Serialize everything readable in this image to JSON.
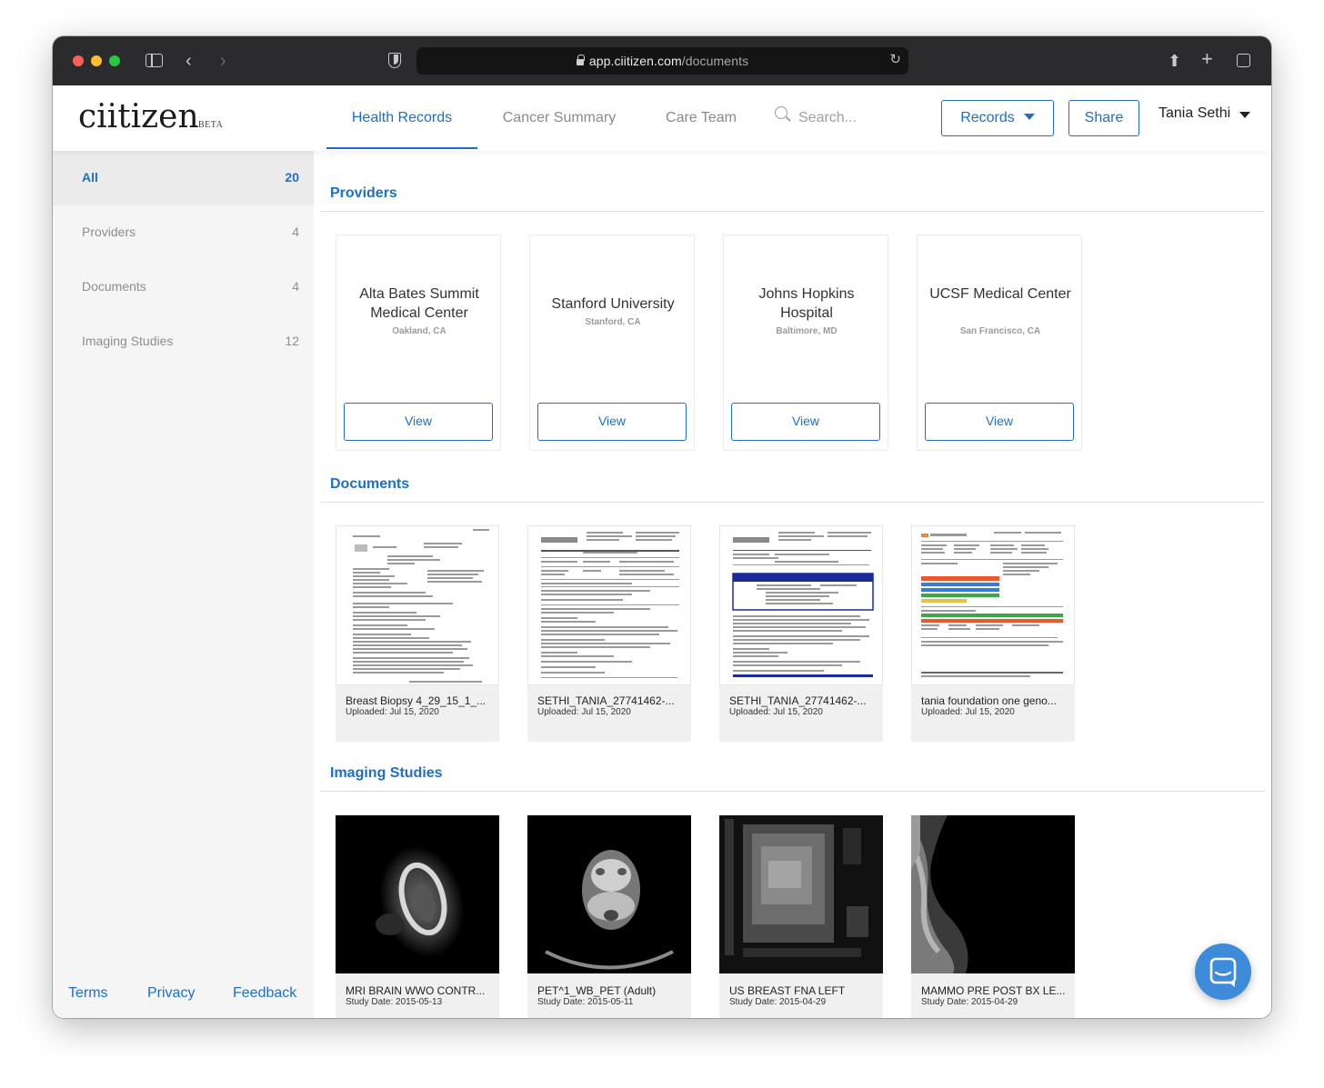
{
  "browser": {
    "url_host": "app.ciitizen.com",
    "url_path": "/documents"
  },
  "header": {
    "logo": "ciitizen",
    "logo_badge": "BETA",
    "tabs": [
      {
        "label": "Health Records",
        "active": true
      },
      {
        "label": "Cancer Summary",
        "active": false
      },
      {
        "label": "Care Team",
        "active": false
      }
    ],
    "search_placeholder": "Search...",
    "records_button": "Records",
    "share_button": "Share",
    "user_name": "Tania Sethi"
  },
  "sidebar": {
    "items": [
      {
        "label": "All",
        "count": "20",
        "active": true
      },
      {
        "label": "Providers",
        "count": "4",
        "active": false
      },
      {
        "label": "Documents",
        "count": "4",
        "active": false
      },
      {
        "label": "Imaging Studies",
        "count": "12",
        "active": false
      }
    ],
    "footer": {
      "terms": "Terms",
      "privacy": "Privacy",
      "feedback": "Feedback"
    }
  },
  "sections": {
    "providers_title": "Providers",
    "documents_title": "Documents",
    "imaging_title": "Imaging Studies"
  },
  "providers": [
    {
      "name": "Alta Bates Summit Medical Center",
      "location": "Oakland, CA",
      "button": "View"
    },
    {
      "name": "Stanford University",
      "location": "Stanford, CA",
      "button": "View"
    },
    {
      "name": "Johns Hopkins Hospital",
      "location": "Baltimore, MD",
      "button": "View"
    },
    {
      "name": "UCSF Medical Center",
      "location": "San Francisco, CA",
      "button": "View"
    }
  ],
  "documents": [
    {
      "name": "Breast Biopsy 4_29_15_1_...",
      "uploaded": "Uploaded: Jul 15, 2020"
    },
    {
      "name": "SETHI_TANIA_27741462-...",
      "uploaded": "Uploaded: Jul 15, 2020"
    },
    {
      "name": "SETHI_TANIA_27741462-...",
      "uploaded": "Uploaded: Jul 15, 2020"
    },
    {
      "name": "tania foundation one geno...",
      "uploaded": "Uploaded: Jul 15, 2020"
    }
  ],
  "imaging": [
    {
      "name": "MRI BRAIN WWO CONTR...",
      "date": "Study Date: 2015-05-13"
    },
    {
      "name": "PET^1_WB_PET (Adult)",
      "date": "Study Date: 2015-05-11"
    },
    {
      "name": "US BREAST FNA LEFT",
      "date": "Study Date: 2015-04-29"
    },
    {
      "name": "MAMMO PRE POST BX LE...",
      "date": "Study Date: 2015-04-29"
    }
  ],
  "colors": {
    "accent": "#1e6fc7",
    "sidebar_bg": "#f5f5f5",
    "chat": "#3e8bd9"
  }
}
